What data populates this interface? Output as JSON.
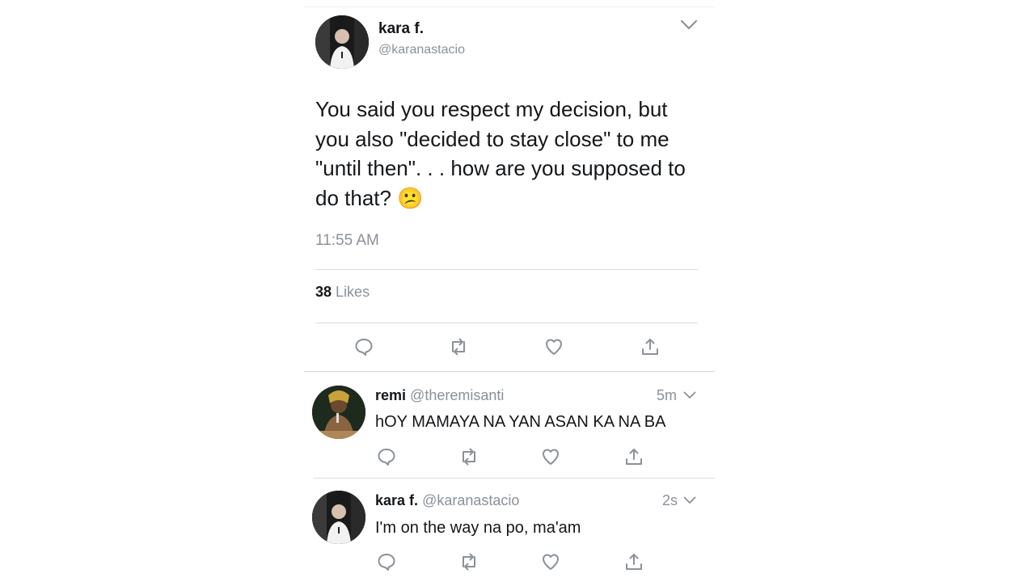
{
  "main_tweet": {
    "name": "kara f.",
    "handle": "@karanastacio",
    "text": "You said you respect my decision, but you also \"decided to stay close\" to me \"until then\". . . how are you supposed to do that?",
    "emoji": "😕",
    "time": "11:55 AM",
    "likes_count": "38",
    "likes_label": "Likes"
  },
  "replies": [
    {
      "name": "remi",
      "handle": "@theremisanti",
      "age": "5m",
      "text": "hOY MAMAYA NA YAN ASAN KA NA BA"
    },
    {
      "name": "kara f.",
      "handle": "@karanastacio",
      "age": "2s",
      "text": "I'm on the way na po, ma'am"
    }
  ],
  "icons": {
    "reply": "reply-icon",
    "retweet": "retweet-icon",
    "like": "heart-icon",
    "share": "share-icon",
    "menu": "chevron-down-icon"
  },
  "colors": {
    "icon": "#8a9199",
    "text": "#14171a",
    "divider": "#d9dde0"
  }
}
